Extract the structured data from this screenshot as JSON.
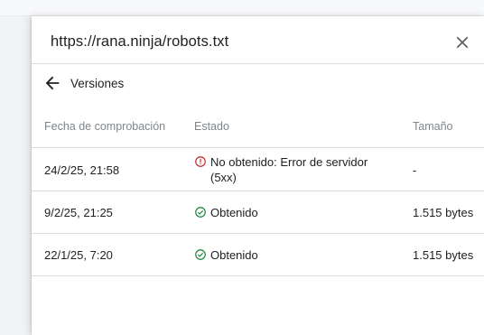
{
  "panel": {
    "title": "https://rana.ninja/robots.txt"
  },
  "subheader": {
    "title": "Versiones"
  },
  "table": {
    "headers": {
      "date": "Fecha de comprobación",
      "status": "Estado",
      "size": "Tamaño"
    },
    "rows": [
      {
        "date": "24/2/25, 21:58",
        "status": "No obtenido: Error de servidor (5xx)",
        "status_type": "error",
        "size": "-"
      },
      {
        "date": "9/2/25, 21:25",
        "status": "Obtenido",
        "status_type": "success",
        "size": "1.515 bytes"
      },
      {
        "date": "22/1/25, 7:20",
        "status": "Obtenido",
        "status_type": "success",
        "size": "1.515 bytes"
      }
    ]
  },
  "colors": {
    "error": "#c5221f",
    "success": "#188038",
    "text": "#202124",
    "muted": "#80868b",
    "divider": "#dadce0"
  },
  "icons": {
    "close": "close-icon",
    "back": "arrow-back-icon",
    "error": "error-circle-icon",
    "success": "check-circle-icon"
  }
}
